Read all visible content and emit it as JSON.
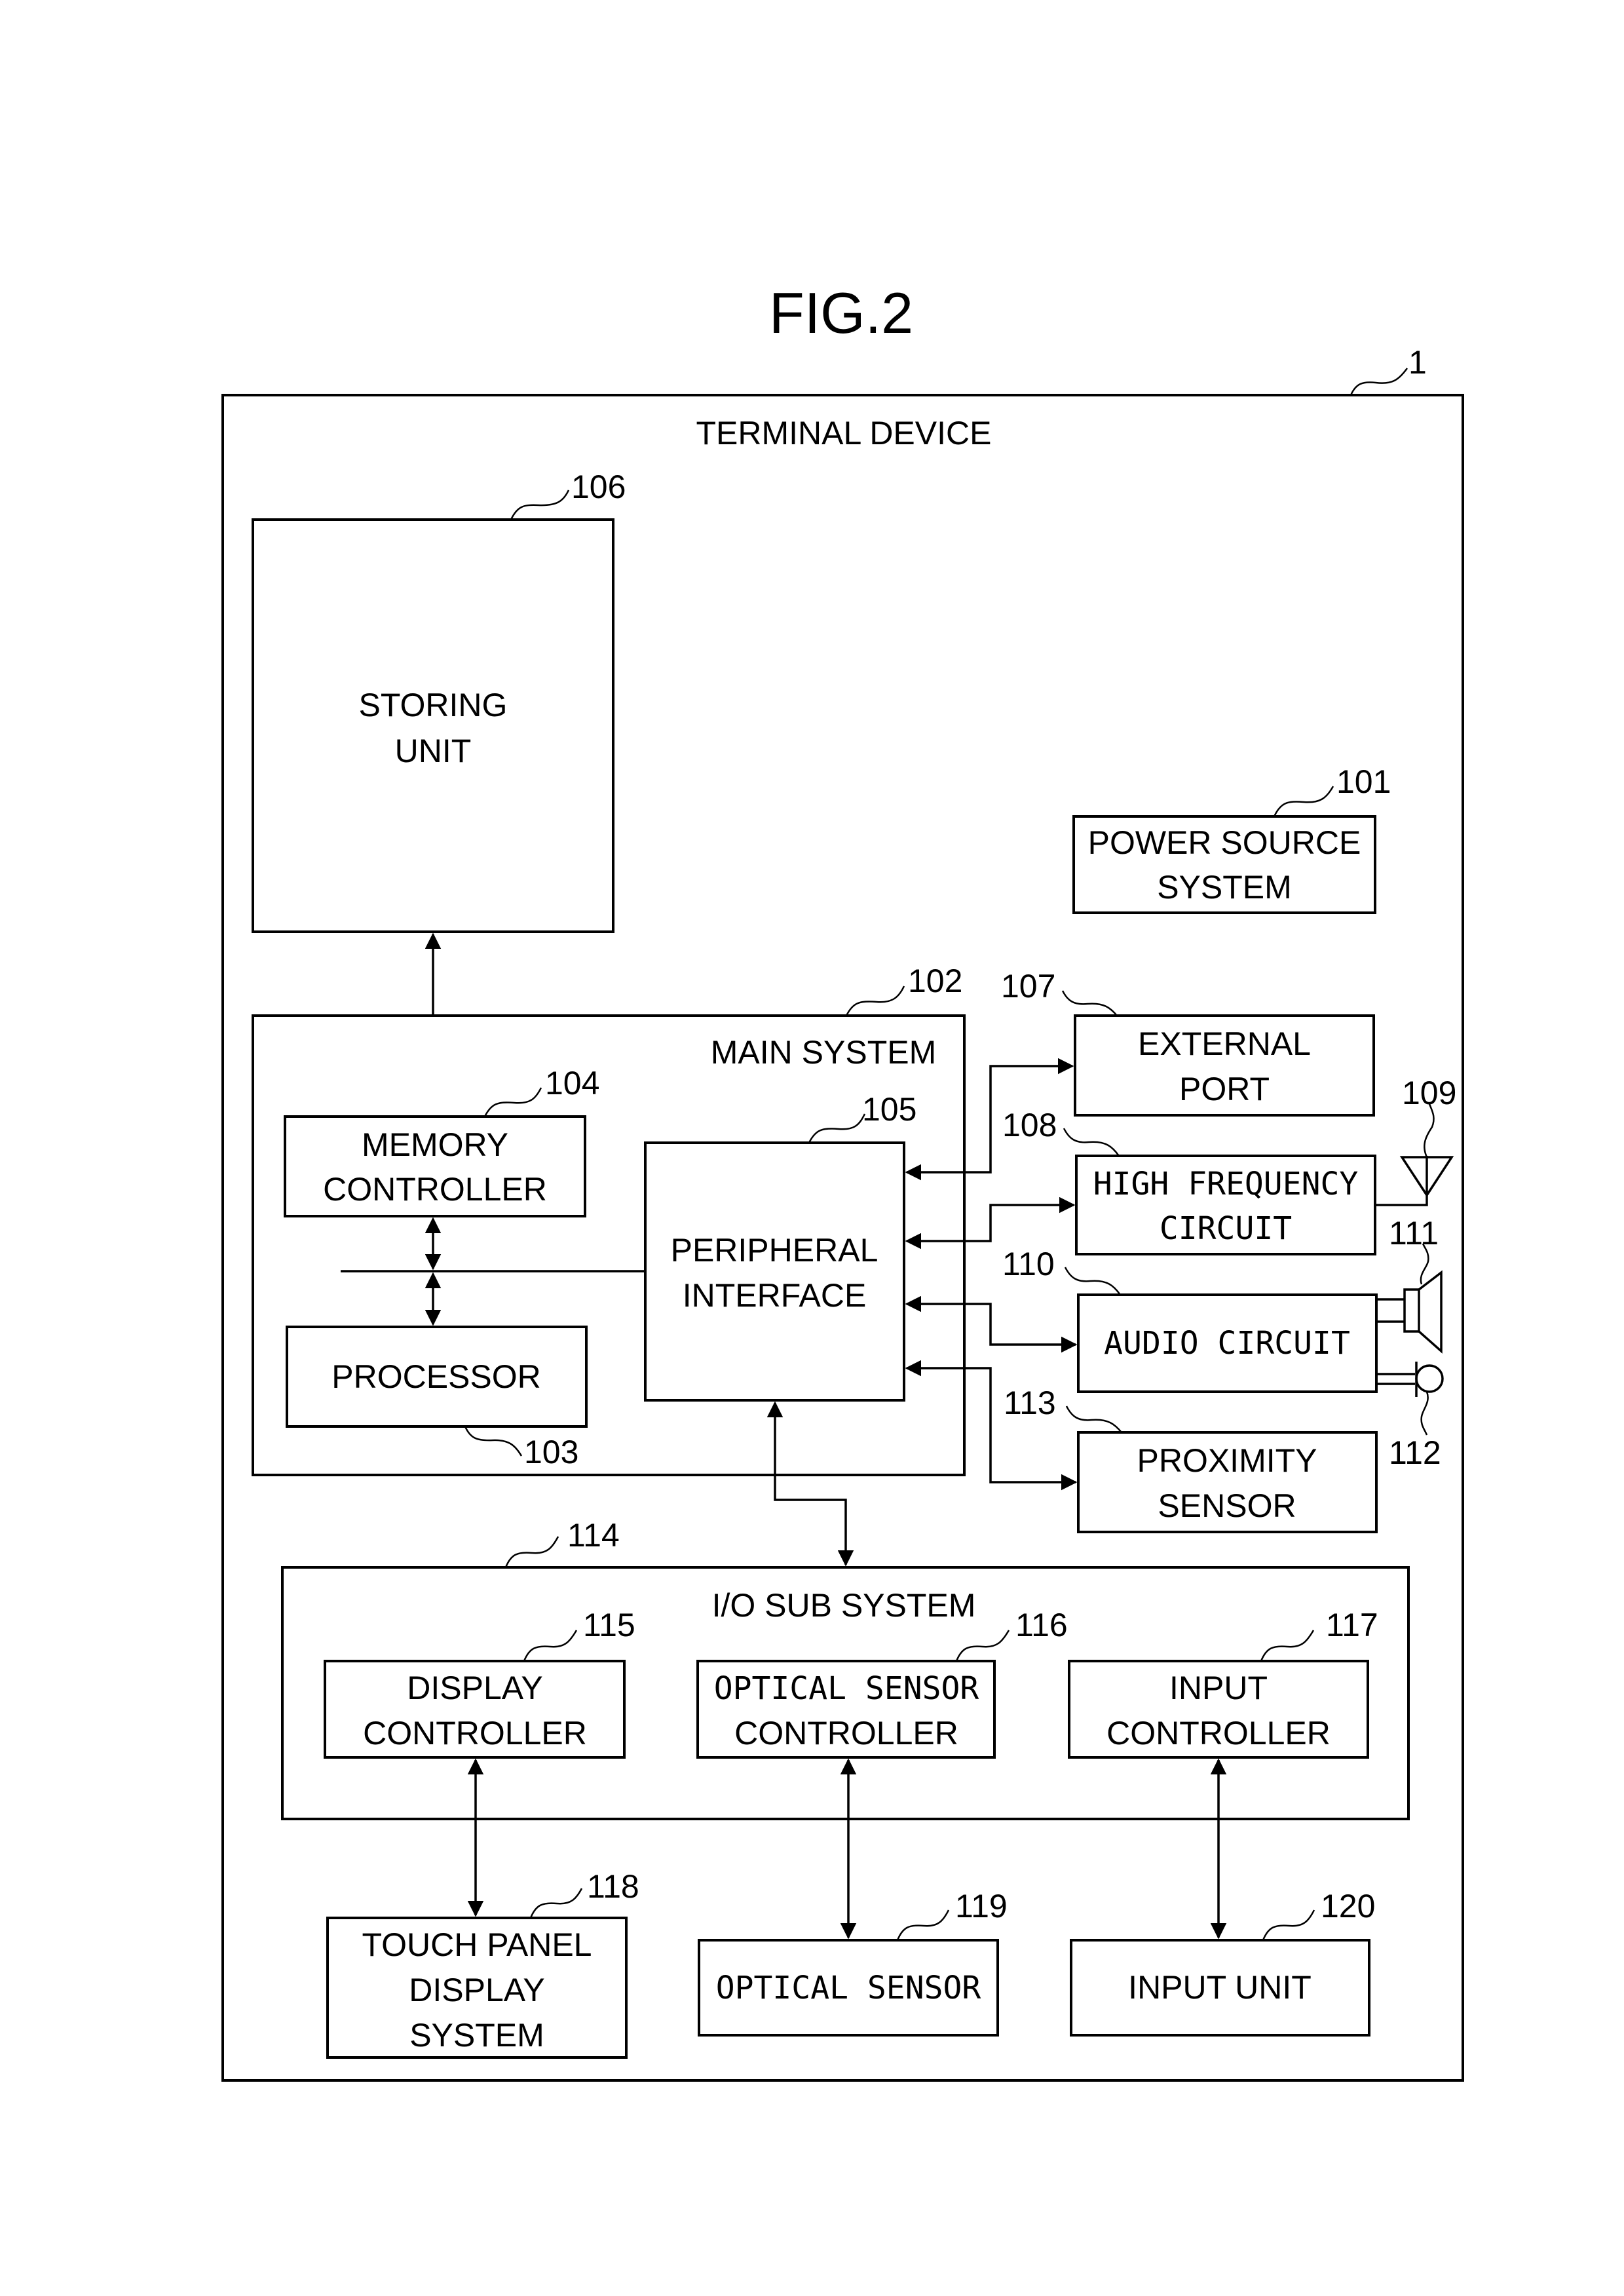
{
  "figure": {
    "title": "FIG.2"
  },
  "device": {
    "ref": "1",
    "title": "TERMINAL DEVICE"
  },
  "storing_unit": {
    "ref": "106",
    "line1": "STORING",
    "line2": "UNIT"
  },
  "power_source": {
    "ref": "101",
    "line1": "POWER SOURCE",
    "line2": "SYSTEM"
  },
  "main_system": {
    "ref": "102",
    "title": "MAIN SYSTEM",
    "memory_controller": {
      "ref": "104",
      "line1": "MEMORY",
      "line2": "CONTROLLER"
    },
    "processor": {
      "ref": "103",
      "line1": "PROCESSOR"
    },
    "peripheral_interface": {
      "ref": "105",
      "line1": "PERIPHERAL",
      "line2": "INTERFACE"
    }
  },
  "external_port": {
    "ref": "107",
    "line1": "EXTERNAL",
    "line2": "PORT"
  },
  "high_frequency": {
    "ref": "108",
    "line1": "HIGH FREQUENCY",
    "line2": "CIRCUIT"
  },
  "antenna": {
    "ref": "109"
  },
  "audio_circuit": {
    "ref": "110",
    "line1": "AUDIO CIRCUIT"
  },
  "speaker": {
    "ref": "111"
  },
  "microphone": {
    "ref": "112"
  },
  "proximity_sensor": {
    "ref": "113",
    "line1": "PROXIMITY",
    "line2": "SENSOR"
  },
  "io_subsystem": {
    "ref": "114",
    "title": "I/O SUB SYSTEM",
    "display_controller": {
      "ref": "115",
      "line1": "DISPLAY",
      "line2": "CONTROLLER"
    },
    "optical_sensor_controller": {
      "ref": "116",
      "line1": "OPTICAL SENSOR",
      "line2": "CONTROLLER"
    },
    "input_controller": {
      "ref": "117",
      "line1": "INPUT",
      "line2": "CONTROLLER"
    }
  },
  "touch_panel": {
    "ref": "118",
    "line1": "TOUCH PANEL",
    "line2": "DISPLAY",
    "line3": "SYSTEM"
  },
  "optical_sensor": {
    "ref": "119",
    "line1": "OPTICAL SENSOR"
  },
  "input_unit": {
    "ref": "120",
    "line1": "INPUT UNIT"
  }
}
